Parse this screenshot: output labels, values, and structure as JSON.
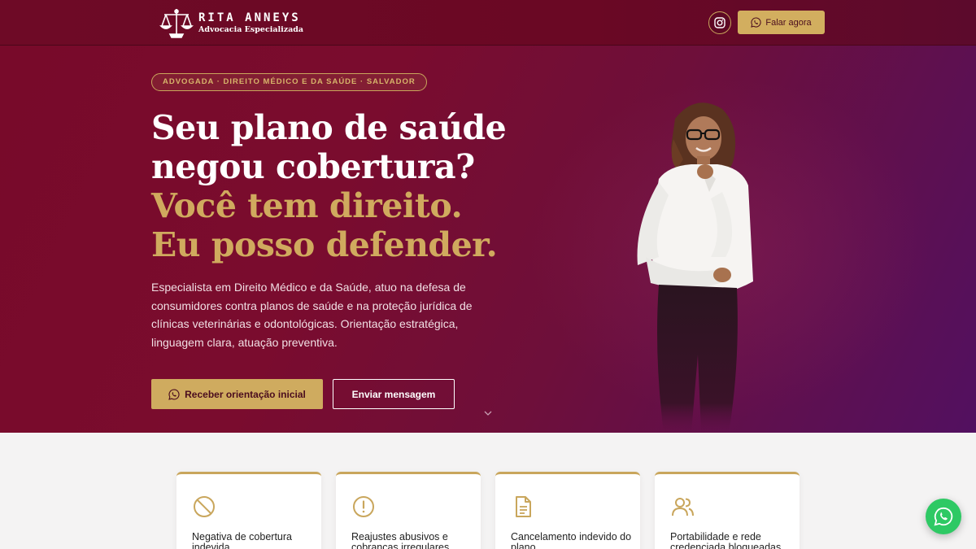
{
  "header": {
    "logo_name": "RITA ANNEYS",
    "logo_subtitle": "Advocacia Especializada",
    "cta_label": "Falar agora"
  },
  "hero": {
    "badge": "ADVOGADA · DIREITO MÉDICO E DA SAÚDE · SALVADOR",
    "headline_line1": "Seu plano de saúde",
    "headline_line2": "negou cobertura?",
    "headline_line3": "Você tem direito.",
    "headline_line4": "Eu posso defender.",
    "lead": "Especialista em Direito Médico e da Saúde, atuo na defesa de consumidores contra planos de saúde e na proteção jurídica de clínicas veterinárias e odontológicas. Orientação estratégica, linguagem clara, atuação preventiva.",
    "primary_button": "Receber orientação inicial",
    "secondary_button": "Enviar mensagem"
  },
  "cards": [
    {
      "icon": "ban-icon",
      "title": "Negativa de cobertura indevida"
    },
    {
      "icon": "alert-circle-icon",
      "title": "Reajustes abusivos e cobranças irregulares"
    },
    {
      "icon": "document-icon",
      "title": "Cancelamento indevido do plano"
    },
    {
      "icon": "users-icon",
      "title": "Portabilidade e rede credenciada bloqueadas"
    }
  ],
  "colors": {
    "brand_wine": "#780a2a",
    "gold": "#cfab5f",
    "whatsapp_green": "#2ec964"
  }
}
